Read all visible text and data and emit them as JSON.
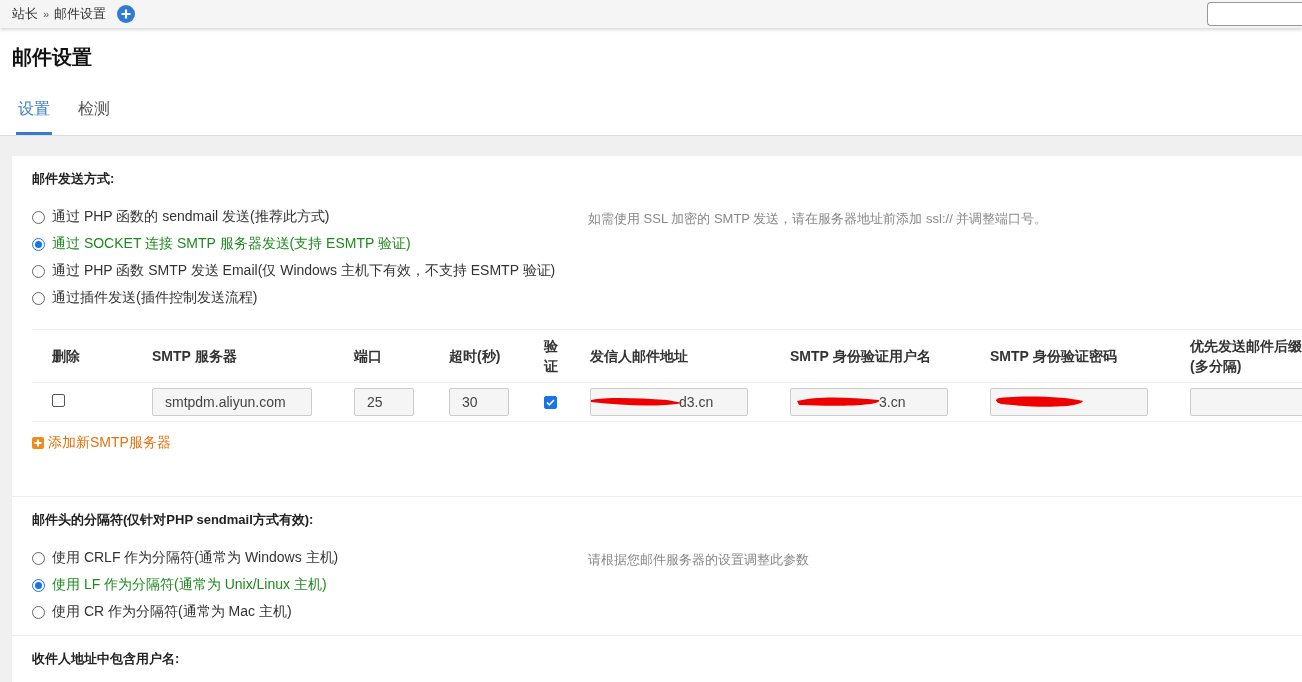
{
  "breadcrumb": {
    "items": [
      "站长",
      "邮件设置"
    ],
    "separator": "»"
  },
  "title": "邮件设置",
  "tabs": [
    {
      "label": "设置",
      "selected": true
    },
    {
      "label": "检测",
      "selected": false
    }
  ],
  "send_method": {
    "heading": "邮件发送方式:",
    "hint": "如需使用 SSL 加密的 SMTP 发送，请在服务器地址前添加 ssl:// 并调整端口号。",
    "options": [
      {
        "label": "通过 PHP 函数的 sendmail 发送(推荐此方式)",
        "selected": false
      },
      {
        "label": "通过 SOCKET 连接 SMTP 服务器发送(支持 ESMTP 验证)",
        "selected": true
      },
      {
        "label": "通过 PHP 函数 SMTP 发送 Email(仅 Windows 主机下有效，不支持 ESMTP 验证)",
        "selected": false
      },
      {
        "label": "通过插件发送(插件控制发送流程)",
        "selected": false
      }
    ]
  },
  "smtp_table": {
    "columns": [
      "删除",
      "SMTP 服务器",
      "端口",
      "超时(秒)",
      "验证",
      "发信人邮件地址",
      "SMTP 身份验证用户名",
      "SMTP 身份验证密码",
      "优先发送邮件后缀(多分隔)"
    ],
    "rows": [
      {
        "delete": false,
        "server": "smtpdm.aliyun.com",
        "port": "25",
        "timeout": "30",
        "verify": true,
        "sender": {
          "value": "d3.cn",
          "redacted": true
        },
        "username": {
          "value": "3.cn",
          "redacted": true
        },
        "password": {
          "redacted": true
        }
      }
    ],
    "add_link": "添加新SMTP服务器"
  },
  "separator_setting": {
    "heading": "邮件头的分隔符(仅针对PHP sendmail方式有效):",
    "hint": "请根据您邮件服务器的设置调整此参数",
    "options": [
      {
        "label": "使用 CRLF 作为分隔符(通常为 Windows 主机)",
        "selected": false
      },
      {
        "label": "使用 LF 作为分隔符(通常为 Unix/Linux 主机)",
        "selected": true
      },
      {
        "label": "使用 CR 作为分隔符(通常为 Mac 主机)",
        "selected": false
      }
    ]
  },
  "next_section": {
    "heading": "收件人地址中包含用户名:"
  }
}
